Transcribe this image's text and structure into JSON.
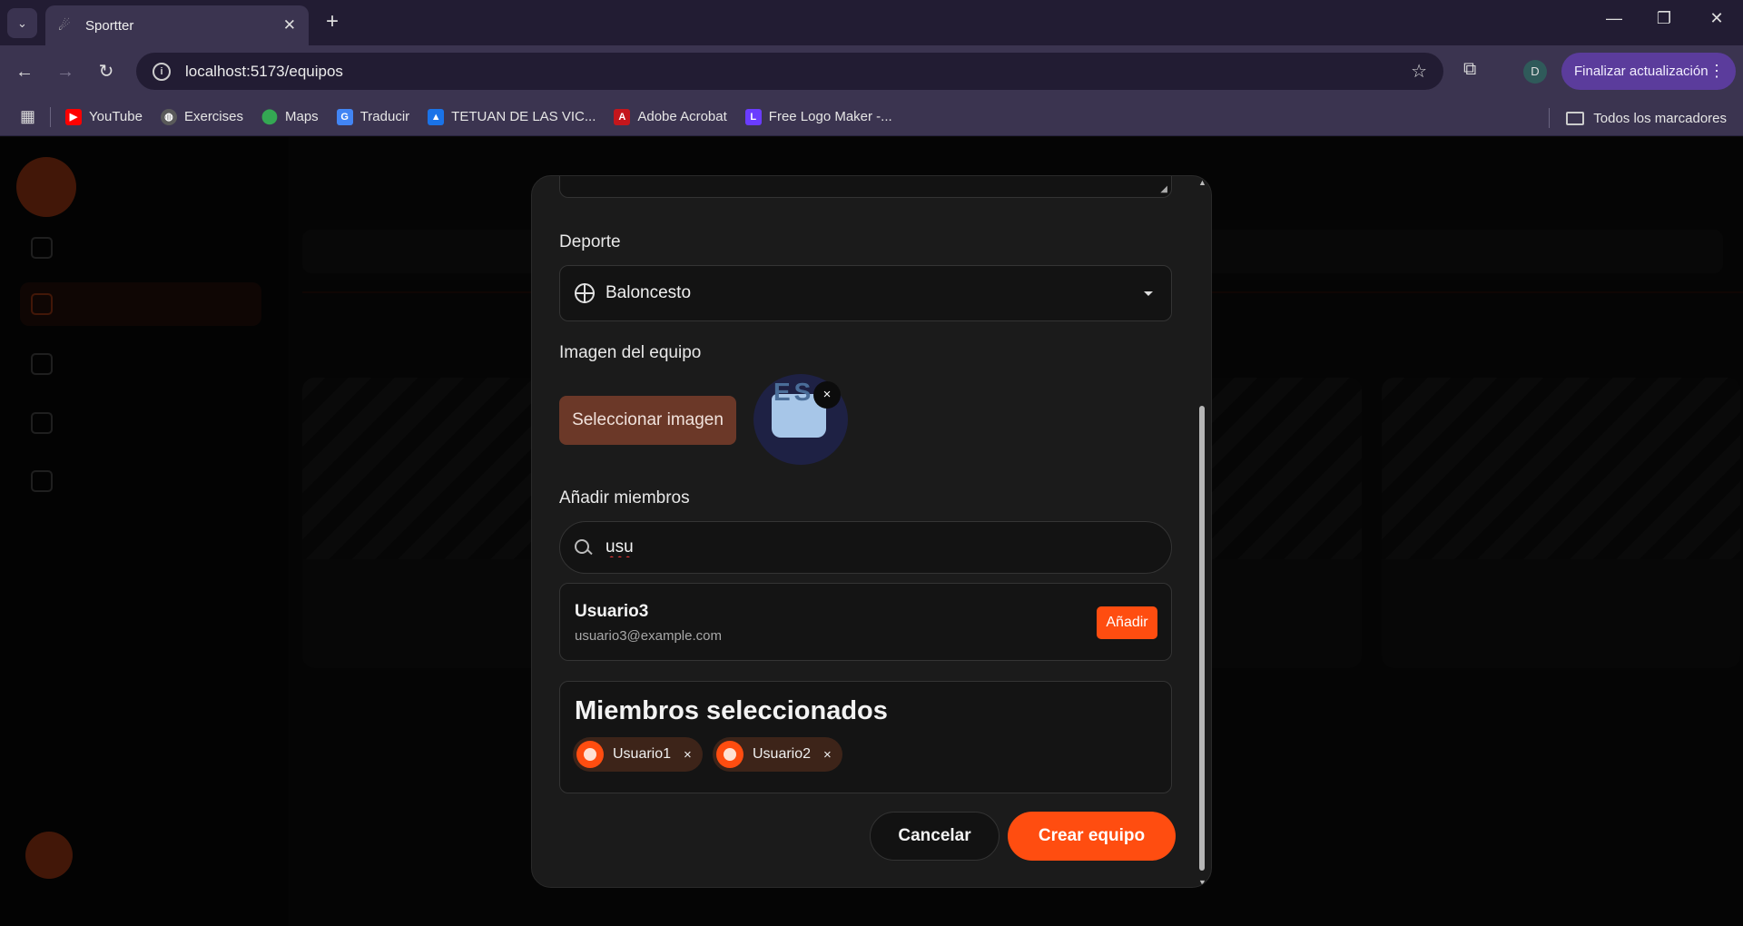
{
  "browser": {
    "tab_title": "Sportter",
    "url": "localhost:5173/equipos",
    "profile_initial": "D",
    "update_label": "Finalizar actualización",
    "bookmarks": [
      {
        "label": "YouTube",
        "icon": "youtube-icon",
        "color": "#ff0000"
      },
      {
        "label": "Exercises",
        "icon": "globe-icon",
        "color": "#5a5a5a"
      },
      {
        "label": "Maps",
        "icon": "maps-pin-icon",
        "color": "#34a853"
      },
      {
        "label": "Traducir",
        "icon": "translate-icon",
        "color": "#4285f4"
      },
      {
        "label": "TETUAN DE LAS VIC...",
        "icon": "school-cap-icon",
        "color": "#1a73e8"
      },
      {
        "label": "Adobe Acrobat",
        "icon": "acrobat-icon",
        "color": "#c4161c"
      },
      {
        "label": "Free Logo Maker -...",
        "icon": "logo-maker-icon",
        "color": "#6a3cff"
      }
    ],
    "all_bookmarks_label": "Todos los marcadores"
  },
  "modal": {
    "sport_label": "Deporte",
    "sport_value": "Baloncesto",
    "image_label": "Imagen del equipo",
    "select_image_button": "Seleccionar imagen",
    "image_remove": "×",
    "add_members_label": "Añadir miembros",
    "member_search_value": "usu",
    "search_result": {
      "name": "Usuario3",
      "email": "usuario3@example.com",
      "add_button": "Añadir"
    },
    "selected_title": "Miembros seleccionados",
    "selected_members": [
      {
        "name": "Usuario1",
        "remove": "×"
      },
      {
        "name": "Usuario2",
        "remove": "×"
      }
    ],
    "cancel_button": "Cancelar",
    "create_button": "Crear equipo"
  },
  "colors": {
    "accent": "#ff4d10",
    "modal_bg": "#1b1b1b",
    "chrome_bg": "#3b3450"
  }
}
